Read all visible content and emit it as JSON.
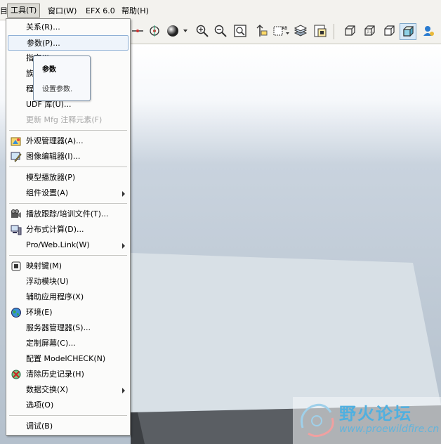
{
  "menubar": {
    "items": [
      {
        "label": "工具(T)"
      },
      {
        "label": "窗口(W)"
      },
      {
        "label": "EFX 6.0"
      },
      {
        "label": "帮助(H)"
      }
    ],
    "left_fragment": "目"
  },
  "tools_menu": {
    "items": [
      {
        "label": "关系(R)...",
        "enabled": true
      },
      {
        "label": "参数(P)...",
        "enabled": true,
        "highlighted": true
      },
      {
        "label": "指定(I)",
        "enabled": true
      },
      {
        "label": "族表(F)...",
        "enabled": true
      },
      {
        "label": "程序(G)...",
        "enabled": true
      },
      {
        "label": "UDF 库(U)...",
        "enabled": true
      },
      {
        "label": "更新 Mfg 注释元素(F)",
        "enabled": false
      },
      {
        "label": "外观管理器(A)...",
        "enabled": true,
        "icon": "appearance-manager-icon"
      },
      {
        "label": "图像编辑器(I)...",
        "enabled": true,
        "icon": "image-editor-icon"
      },
      {
        "label": "模型播放器(P)",
        "enabled": true
      },
      {
        "label": "组件设置(A)",
        "enabled": true,
        "submenu": true
      },
      {
        "label": "播放跟踪/培训文件(T)...",
        "enabled": true,
        "icon": "trail-file-icon"
      },
      {
        "label": "分布式计算(D)...",
        "enabled": true,
        "icon": "distributed-computing-icon"
      },
      {
        "label": "Pro/Web.Link(W)",
        "enabled": true,
        "submenu": true
      },
      {
        "label": "映射键(M)",
        "enabled": true,
        "icon": "mapkey-icon"
      },
      {
        "label": "浮动模块(U)",
        "enabled": true
      },
      {
        "label": "辅助应用程序(X)",
        "enabled": true
      },
      {
        "label": "环境(E)",
        "enabled": true,
        "icon": "environment-icon"
      },
      {
        "label": "服务器管理器(S)...",
        "enabled": true
      },
      {
        "label": "定制屏幕(C)...",
        "enabled": true
      },
      {
        "label": "配置 ModelCHECK(N)",
        "enabled": true
      },
      {
        "label": "清除历史记录(H)",
        "enabled": true,
        "icon": "clear-history-icon"
      },
      {
        "label": "数据交换(X)",
        "enabled": true,
        "submenu": true
      },
      {
        "label": "选项(O)",
        "enabled": true
      },
      {
        "label": "调试(B)",
        "enabled": true
      }
    ]
  },
  "tooltip": {
    "title": "参数",
    "description": "设置参数."
  },
  "toolbar": {
    "icons": [
      "datum-axis-icon",
      "spin-center-icon",
      "shading-sphere-icon",
      "zoom-in-icon",
      "zoom-out-icon",
      "refit-icon",
      "reorient-icon",
      "saved-views-icon",
      "layers-icon",
      "view-manager-icon",
      "wireframe-icon",
      "hidden-line-icon",
      "no-hidden-icon",
      "shading-icon",
      "model-tree-icon"
    ]
  },
  "watermark": {
    "title": "野火论坛",
    "url": "www.proewildfire.cn"
  },
  "colors": {
    "menu_highlight_border": "#8fb0d6",
    "menu_bg": "#fbfbfa",
    "toolbar_bg": "#f3f2ee",
    "viewport_bottom": "#b4c0cc",
    "plate": "#d8e0e6",
    "watermark": "#4fb0e0"
  }
}
